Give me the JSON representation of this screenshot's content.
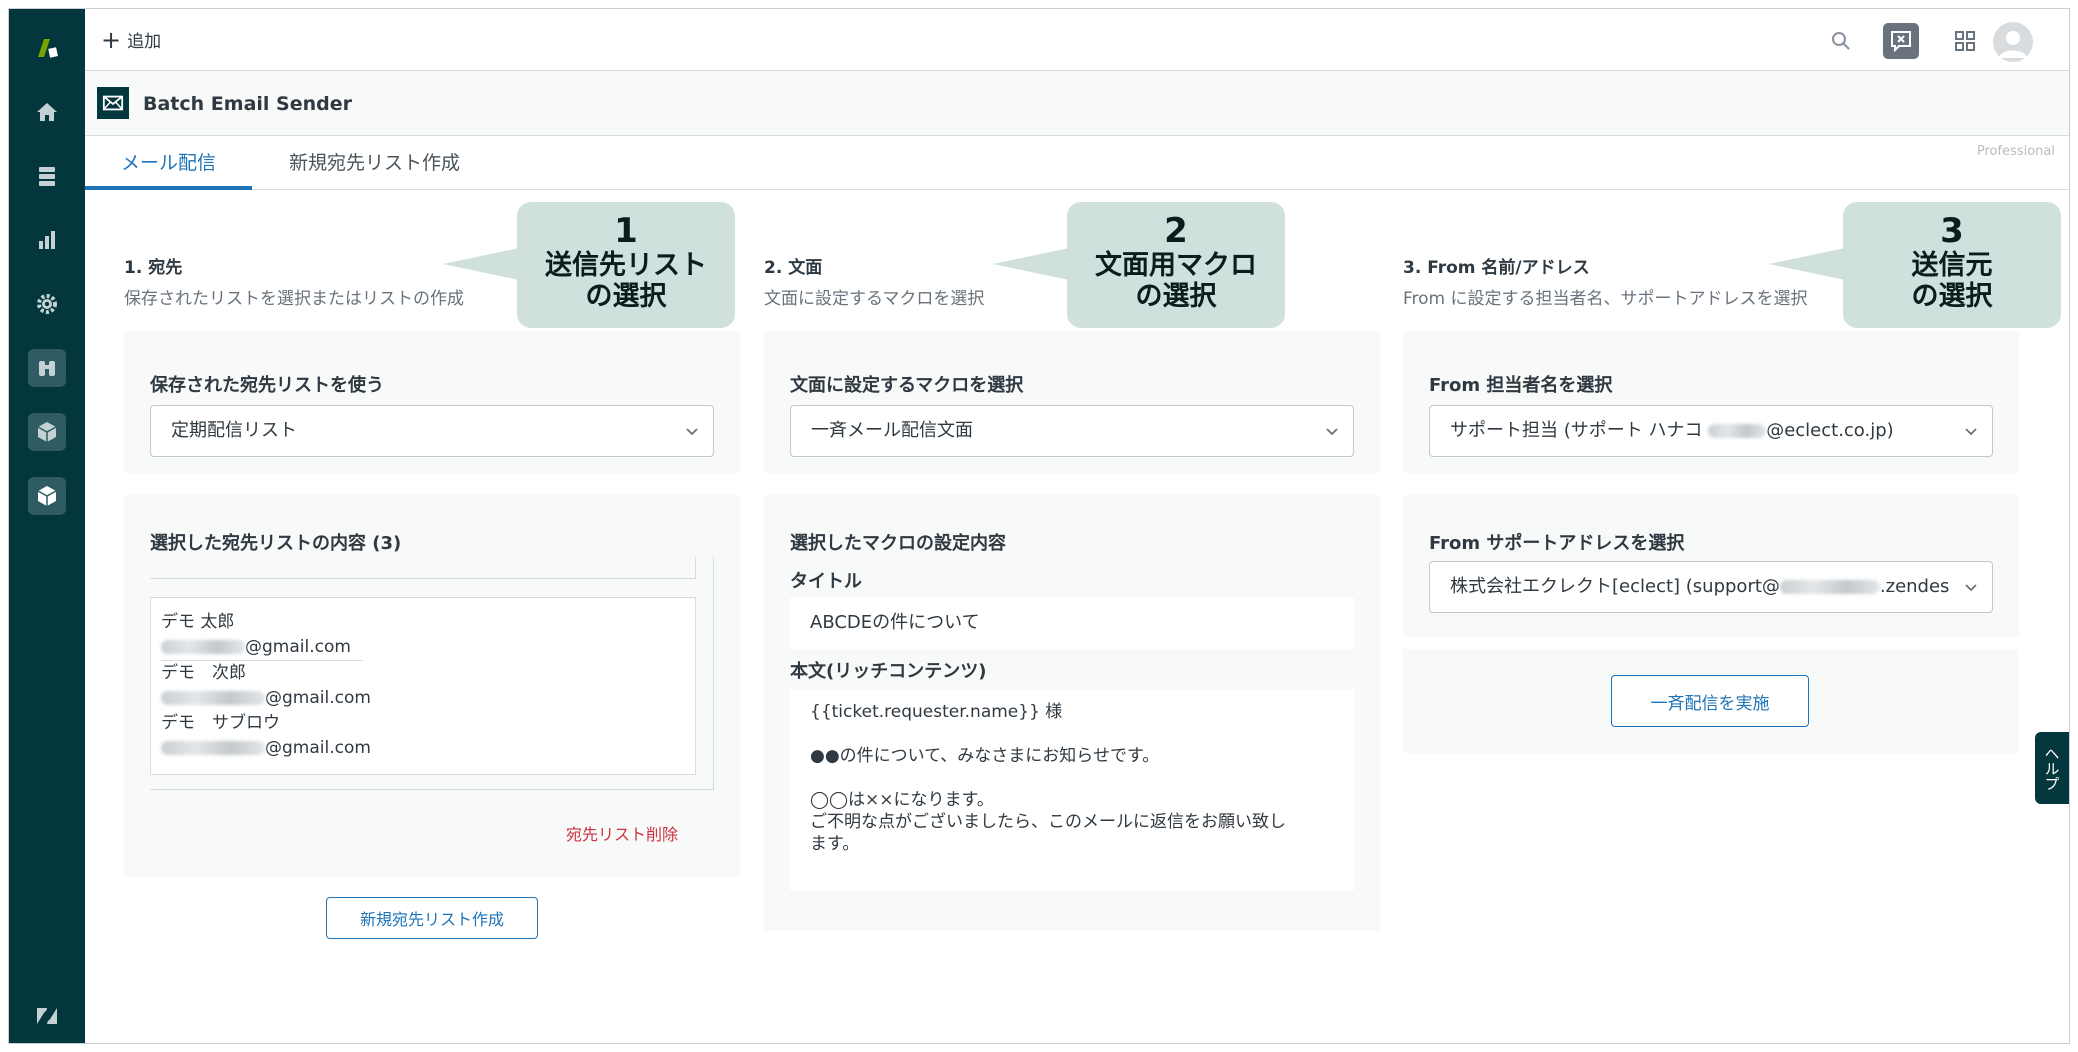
{
  "topbar": {
    "add_label": "追加"
  },
  "app": {
    "title": "Batch Email Sender",
    "plan": "Professional"
  },
  "tabs": [
    {
      "label": "メール配信",
      "active": true
    },
    {
      "label": "新規宛先リスト作成",
      "active": false
    }
  ],
  "col1": {
    "title": "1. 宛先",
    "subtitle": "保存されたリストを選択またはリストの作成",
    "saved_list_label": "保存された宛先リストを使う",
    "saved_list_value": "定期配信リスト",
    "list_contents_label": "選択した宛先リストの内容 (3)",
    "entries": [
      {
        "name": "デモ 太郎",
        "email_domain": "@gmail.com"
      },
      {
        "name": "デモ　次郎",
        "email_domain": "@gmail.com"
      },
      {
        "name": "デモ　サブロウ",
        "email_domain": "@gmail.com"
      }
    ],
    "delete_link": "宛先リスト削除",
    "new_list_button": "新規宛先リスト作成"
  },
  "col2": {
    "title": "2. 文面",
    "subtitle": "文面に設定するマクロを選択",
    "macro_label": "文面に設定するマクロを選択",
    "macro_value": "一斉メール配信文面",
    "macro_detail_label": "選択したマクロの設定内容",
    "subject_label": "タイトル",
    "subject_value": "ABCDEの件について",
    "body_label": "本文(リッチコンテンツ)",
    "body_lines": [
      "{{ticket.requester.name}} 様",
      "●●の件について、みなさまにお知らせです。",
      "◯◯は××になります。",
      "ご不明な点がございましたら、このメールに返信をお願い致し",
      "ます。"
    ]
  },
  "col3": {
    "title": "3. From 名前/アドレス",
    "subtitle": "From に設定する担当者名、サポートアドレスを選択",
    "agent_label": "From 担当者名を選択",
    "agent_value_prefix": "サポート担当 (サポート ハナコ ",
    "agent_value_suffix": "@eclect.co.jp)",
    "address_label": "From サポートアドレスを選択",
    "address_value_prefix": "株式会社エクレクト[eclect] (support@",
    "address_value_suffix": ".zendes",
    "send_button": "一斉配信を実施"
  },
  "callouts": [
    {
      "num": "1",
      "line1": "送信先リスト",
      "line2": "の選択"
    },
    {
      "num": "2",
      "line1": "文面用マクロ",
      "line2": "の選択"
    },
    {
      "num": "3",
      "line1": "送信元",
      "line2": "の選択"
    }
  ],
  "help_label": "ヘルプ",
  "colors": {
    "sidebar": "#03363d",
    "accent": "#1f73b7",
    "danger": "#cc3340",
    "callout": "#cfe0dd",
    "card": "#f8f9f9"
  },
  "icons": [
    "zendesk-logo-icon",
    "home-icon",
    "views-icon",
    "reporting-icon",
    "settings-icon",
    "binoculars-icon",
    "app-box-icon",
    "app-box-active-icon",
    "zendesk-z-icon",
    "search-icon",
    "chat-icon",
    "apps-grid-icon",
    "avatar-icon",
    "mail-icon",
    "chevron-down-icon"
  ]
}
